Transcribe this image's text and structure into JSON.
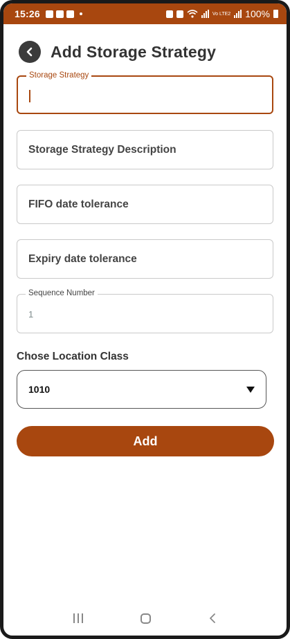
{
  "status_bar": {
    "time": "15:26",
    "network_label": "Vo LTE2",
    "battery_percent": "100%"
  },
  "header": {
    "title": "Add Storage Strategy"
  },
  "form": {
    "storage_strategy": {
      "label": "Storage Strategy",
      "value": ""
    },
    "description": {
      "placeholder": "Storage Strategy Description"
    },
    "fifo": {
      "placeholder": "FIFO date tolerance"
    },
    "expiry": {
      "placeholder": "Expiry date tolerance"
    },
    "sequence": {
      "label": "Sequence Number",
      "value": "1"
    },
    "location_class": {
      "label": "Chose Location Class",
      "selected": "1010"
    },
    "submit_label": "Add"
  },
  "colors": {
    "accent": "#a8470f",
    "text_dark": "#333333"
  },
  "icons": [
    "back-arrow-icon",
    "dropdown-caret-icon",
    "recent-apps-icon",
    "home-icon",
    "back-nav-icon"
  ]
}
